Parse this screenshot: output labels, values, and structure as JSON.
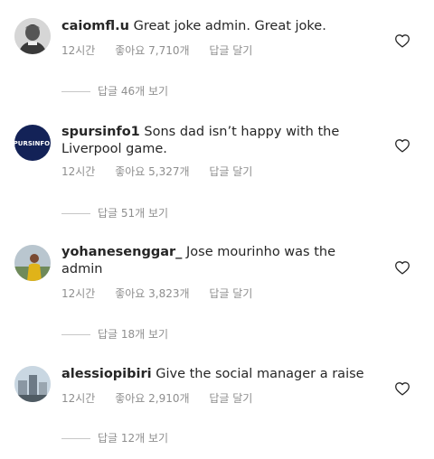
{
  "comments": [
    {
      "username": "caiomfl.u",
      "text": "Great joke admin. Great joke.",
      "time": "12시간",
      "likes": "좋아요 7,710개",
      "reply": "답글 달기",
      "view_replies": "답글 46개 보기",
      "avatar_icon": "profile-photo-bw"
    },
    {
      "username": "spursinfo1",
      "text": "Sons dad isn’t happy with the Liverpool game.",
      "time": "12시간",
      "likes": "좋아요 5,327개",
      "reply": "답글 달기",
      "view_replies": "답글 51개 보기",
      "avatar_icon": "spurs-logo-navy",
      "avatar_logo_text": "SPURSINFO 1"
    },
    {
      "username": "yohanesenggar_",
      "text": "Jose mourinho was the admin",
      "time": "12시간",
      "likes": "좋아요 3,823개",
      "reply": "답글 달기",
      "view_replies": "답글 18개 보기",
      "avatar_icon": "profile-photo-outdoor"
    },
    {
      "username": "alessiopibiri",
      "text": "Give the social manager a raise",
      "time": "12시간",
      "likes": "좋아요 2,910개",
      "reply": "답글 달기",
      "view_replies": "답글 12개 보기",
      "avatar_icon": "profile-photo-city"
    }
  ],
  "colors": {
    "text": "#262626",
    "secondary": "#8e8e8e",
    "divider": "#c7c7c7",
    "spurs_navy": "#132257"
  },
  "icons": {
    "like": "heart-outline-icon"
  }
}
